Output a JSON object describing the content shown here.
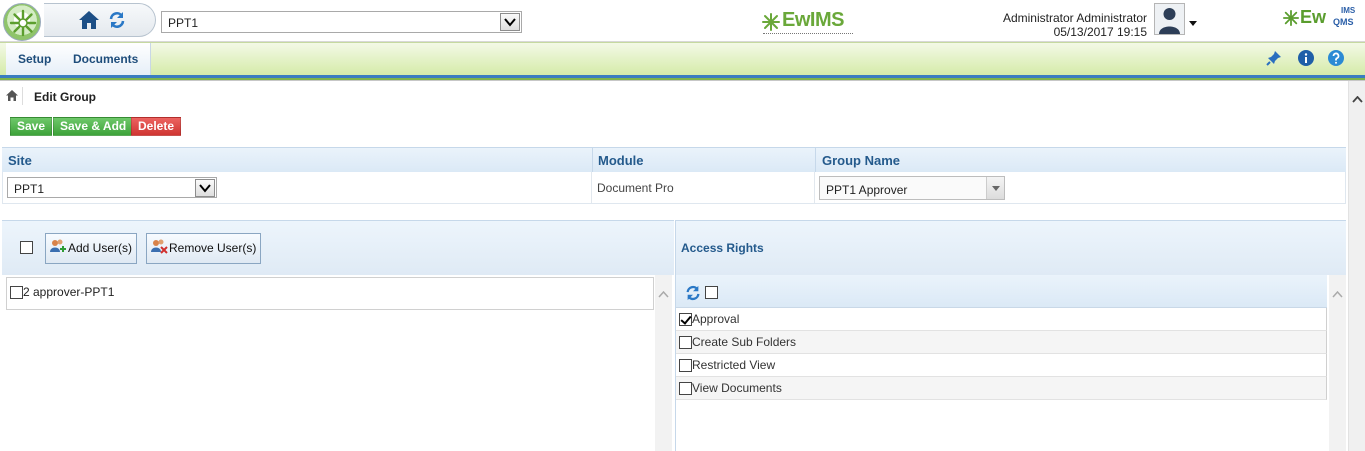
{
  "header": {
    "site_selector_value": "PPT1",
    "brand_center": "EwIMS",
    "user_name": "Administrator Administrator",
    "datetime": "05/13/2017 19:15",
    "brand_right_main": "Ew",
    "brand_right_ims": "IMS",
    "brand_right_qms": "QMS",
    "icons": [
      "app-logo",
      "home-icon",
      "refresh-icon",
      "chevron-down-icon",
      "user-avatar",
      "caret-down-icon"
    ]
  },
  "menu": {
    "items": [
      "Setup",
      "Documents"
    ],
    "right_icons": [
      "pin-icon",
      "info-icon",
      "help-icon"
    ]
  },
  "breadcrumb": {
    "title": "Edit Group"
  },
  "toolbar": {
    "save": "Save",
    "save_add": "Save & Add",
    "delete": "Delete"
  },
  "form": {
    "headers": {
      "site": "Site",
      "module": "Module",
      "group_name": "Group Name"
    },
    "site_value": "PPT1",
    "module_value": "Document Pro",
    "group_name_value": "PPT1 Approver"
  },
  "users": {
    "add_button": "Add User(s)",
    "remove_button": "Remove User(s)",
    "items": [
      "2 approver-PPT1"
    ]
  },
  "access_rights": {
    "title": "Access Rights",
    "items": [
      {
        "label": "Approval",
        "checked": true
      },
      {
        "label": "Create Sub Folders",
        "checked": false
      },
      {
        "label": "Restricted View",
        "checked": false
      },
      {
        "label": "View Documents",
        "checked": false
      }
    ]
  },
  "colors": {
    "accent_green": "#4cae48",
    "delete_red": "#d9413e",
    "header_blue": "#245a8c"
  }
}
